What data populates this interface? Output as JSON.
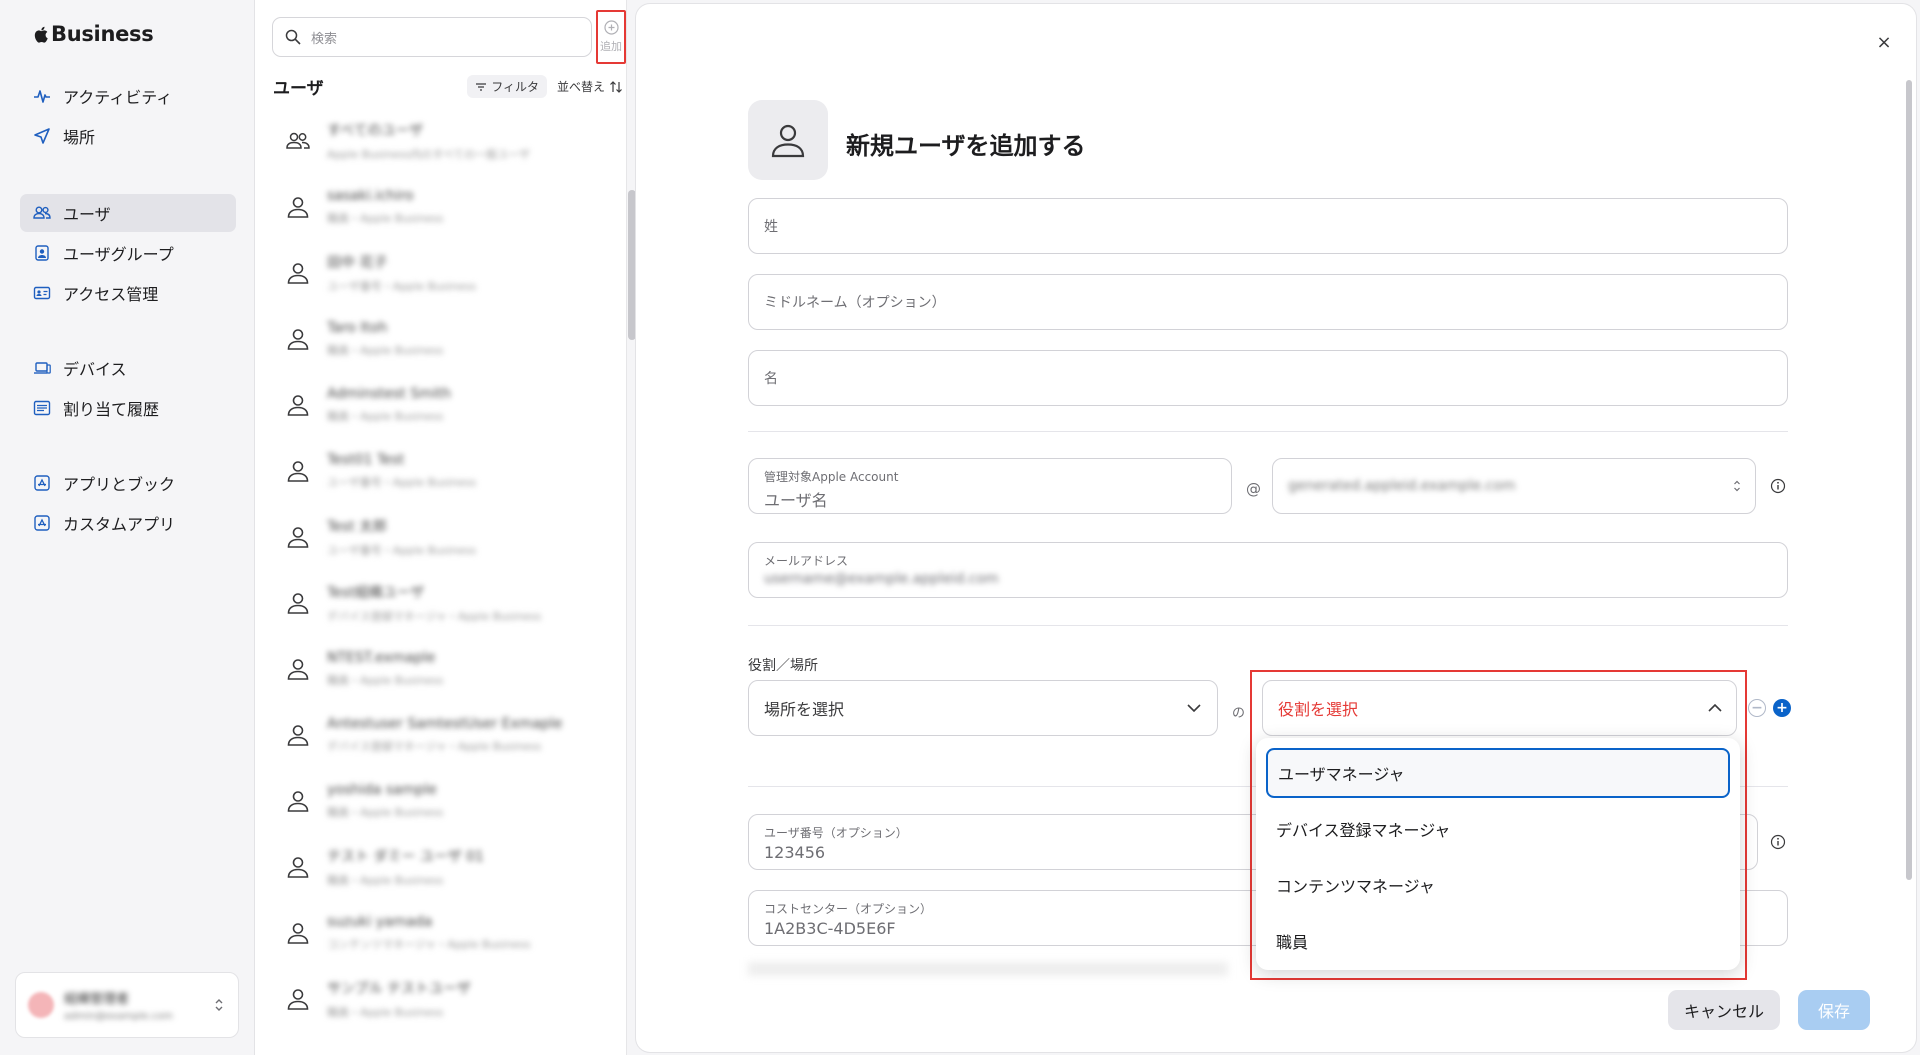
{
  "brand": {
    "apple": "",
    "name": "Business"
  },
  "sidebar": {
    "groups": [
      [
        {
          "label": "アクティビティ",
          "icon": "activity-icon"
        },
        {
          "label": "場所",
          "icon": "location-icon"
        }
      ],
      [
        {
          "label": "ユーザ",
          "icon": "users-icon",
          "active": true
        },
        {
          "label": "ユーザグループ",
          "icon": "user-group-icon"
        },
        {
          "label": "アクセス管理",
          "icon": "id-card-icon"
        }
      ],
      [
        {
          "label": "デバイス",
          "icon": "devices-icon"
        },
        {
          "label": "割り当て履歴",
          "icon": "history-list-icon"
        }
      ],
      [
        {
          "label": "アプリとブック",
          "icon": "app-store-icon"
        },
        {
          "label": "カスタムアプリ",
          "icon": "custom-app-icon"
        }
      ]
    ],
    "account": {
      "name": "組織管理者",
      "sub": "admin@example.com"
    }
  },
  "list": {
    "search_placeholder": "検索",
    "add_label": "追加",
    "title": "ユーザ",
    "filter_label": "フィルタ",
    "sort_label": "並べ替え",
    "users": [
      {
        "name": "すべてのユーザ",
        "sub": "Apple Business内のすべての一般ユーザ",
        "group": true
      },
      {
        "name": "sasaki.ichiro",
        "sub": "職員・Apple Business"
      },
      {
        "name": "田中 花子",
        "sub": "ユーザ番号・Apple Business"
      },
      {
        "name": "Taro Itoh",
        "sub": "職員・Apple Business"
      },
      {
        "name": "Adminstest Smith",
        "sub": "職員・Apple Business"
      },
      {
        "name": "Test01 Test",
        "sub": "ユーザ番号・Apple Business"
      },
      {
        "name": "Test 太郎",
        "sub": "ユーザ番号・Apple Business"
      },
      {
        "name": "Test組織ユーザ",
        "sub": "デバイス登録マネージャ・Apple Business"
      },
      {
        "name": "NTEST.exmaple",
        "sub": "職員・Apple Business"
      },
      {
        "name": "Antestuser SamtestUser Exmaple",
        "sub": "デバイス登録マネージャ・Apple Business"
      },
      {
        "name": "yoshida sample",
        "sub": "職員・Apple Business"
      },
      {
        "name": "テスト ダミー ユーザ 01",
        "sub": "職員・Apple Business"
      },
      {
        "name": "suzuki yamada",
        "sub": "コンテンツマネージャ・Apple Business"
      },
      {
        "name": "サンプル テストユーザ",
        "sub": "職員・Apple Business"
      }
    ]
  },
  "modal": {
    "title": "新規ユーザを追加する",
    "close_symbol": "×",
    "fields": {
      "last_name": "姓",
      "middle_name": "ミドルネーム（オプション）",
      "first_name": "名",
      "managed_account_label": "管理対象Apple Account",
      "username_placeholder": "ユーザ名",
      "at": "@",
      "domain_value": "generated.appleid.example.com",
      "email_label": "メールアドレス",
      "email_value": "username@example.appleid.com",
      "role_section_label": "役割／場所",
      "location_placeholder": "場所を選択",
      "of": "の",
      "role_placeholder": "役割を選択",
      "employee_id_label": "ユーザ番号（オプション）",
      "employee_id_value": "123456",
      "cost_center_label": "コストセンター（オプション）",
      "cost_center_value": "1A2B3C-4D5E6F"
    },
    "role_options": [
      "ユーザマネージャ",
      "デバイス登録マネージャ",
      "コンテンツマネージャ",
      "職員"
    ],
    "cancel_label": "キャンセル",
    "save_label": "保存"
  },
  "colors": {
    "accent": "#0a63c9",
    "highlight": "#e53935",
    "save_disabled": "#a9cdf2"
  }
}
